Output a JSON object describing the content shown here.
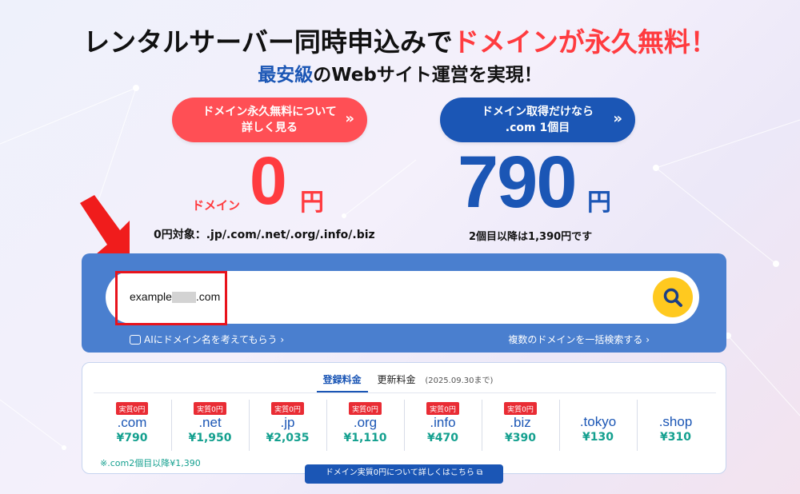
{
  "headline": {
    "main": "レンタルサーバー同時申込みで",
    "accent": "ドメインが永久無料！"
  },
  "subline": {
    "accent": "最安級",
    "rest": "のWebサイト運営を実現！"
  },
  "pill_left": {
    "line1": "ドメイン永久無料について",
    "line2": "詳しく見る",
    "chevron": "»"
  },
  "pill_right": {
    "line1": "ドメイン取得だけなら",
    "line2": ".com 1個目",
    "chevron": "»"
  },
  "offer_free": {
    "prefix": "ドメイン",
    "amount": "0",
    "unit": "円",
    "note": "0円対象：.jp/.com/.net/.org/.info/.biz"
  },
  "offer_com": {
    "amount": "790",
    "unit": "円",
    "note": "2個目以降は1,390円です"
  },
  "search": {
    "value_prefix": "example",
    "value_suffix": ".com"
  },
  "links": {
    "ai": "AIにドメイン名を考えてもらう ›",
    "multi": "複数のドメインを一括検索する ›"
  },
  "tabs": {
    "register": "登録料金",
    "renew": "更新料金",
    "note": "(2025.09.30まで)"
  },
  "tlds": [
    {
      "badge": "実質0円",
      "name": ".com",
      "price": "¥790"
    },
    {
      "badge": "実質0円",
      "name": ".net",
      "price": "¥1,950"
    },
    {
      "badge": "実質0円",
      "name": ".jp",
      "price": "¥2,035"
    },
    {
      "badge": "実質0円",
      "name": ".org",
      "price": "¥1,110"
    },
    {
      "badge": "実質0円",
      "name": ".info",
      "price": "¥470"
    },
    {
      "badge": "実質0円",
      "name": ".biz",
      "price": "¥390"
    },
    {
      "badge": "",
      "name": ".tokyo",
      "price": "¥130"
    },
    {
      "badge": "",
      "name": ".shop",
      "price": "¥310"
    }
  ],
  "com_note": "※.com2個目以降¥1,390",
  "detail_button": "ドメイン実質0円について詳しくはこちら",
  "colors": {
    "red": "#ff3b3f",
    "blue": "#1b56b5",
    "panel": "#4a7fcf",
    "yellow": "#ffc91f",
    "teal": "#14a08f"
  }
}
